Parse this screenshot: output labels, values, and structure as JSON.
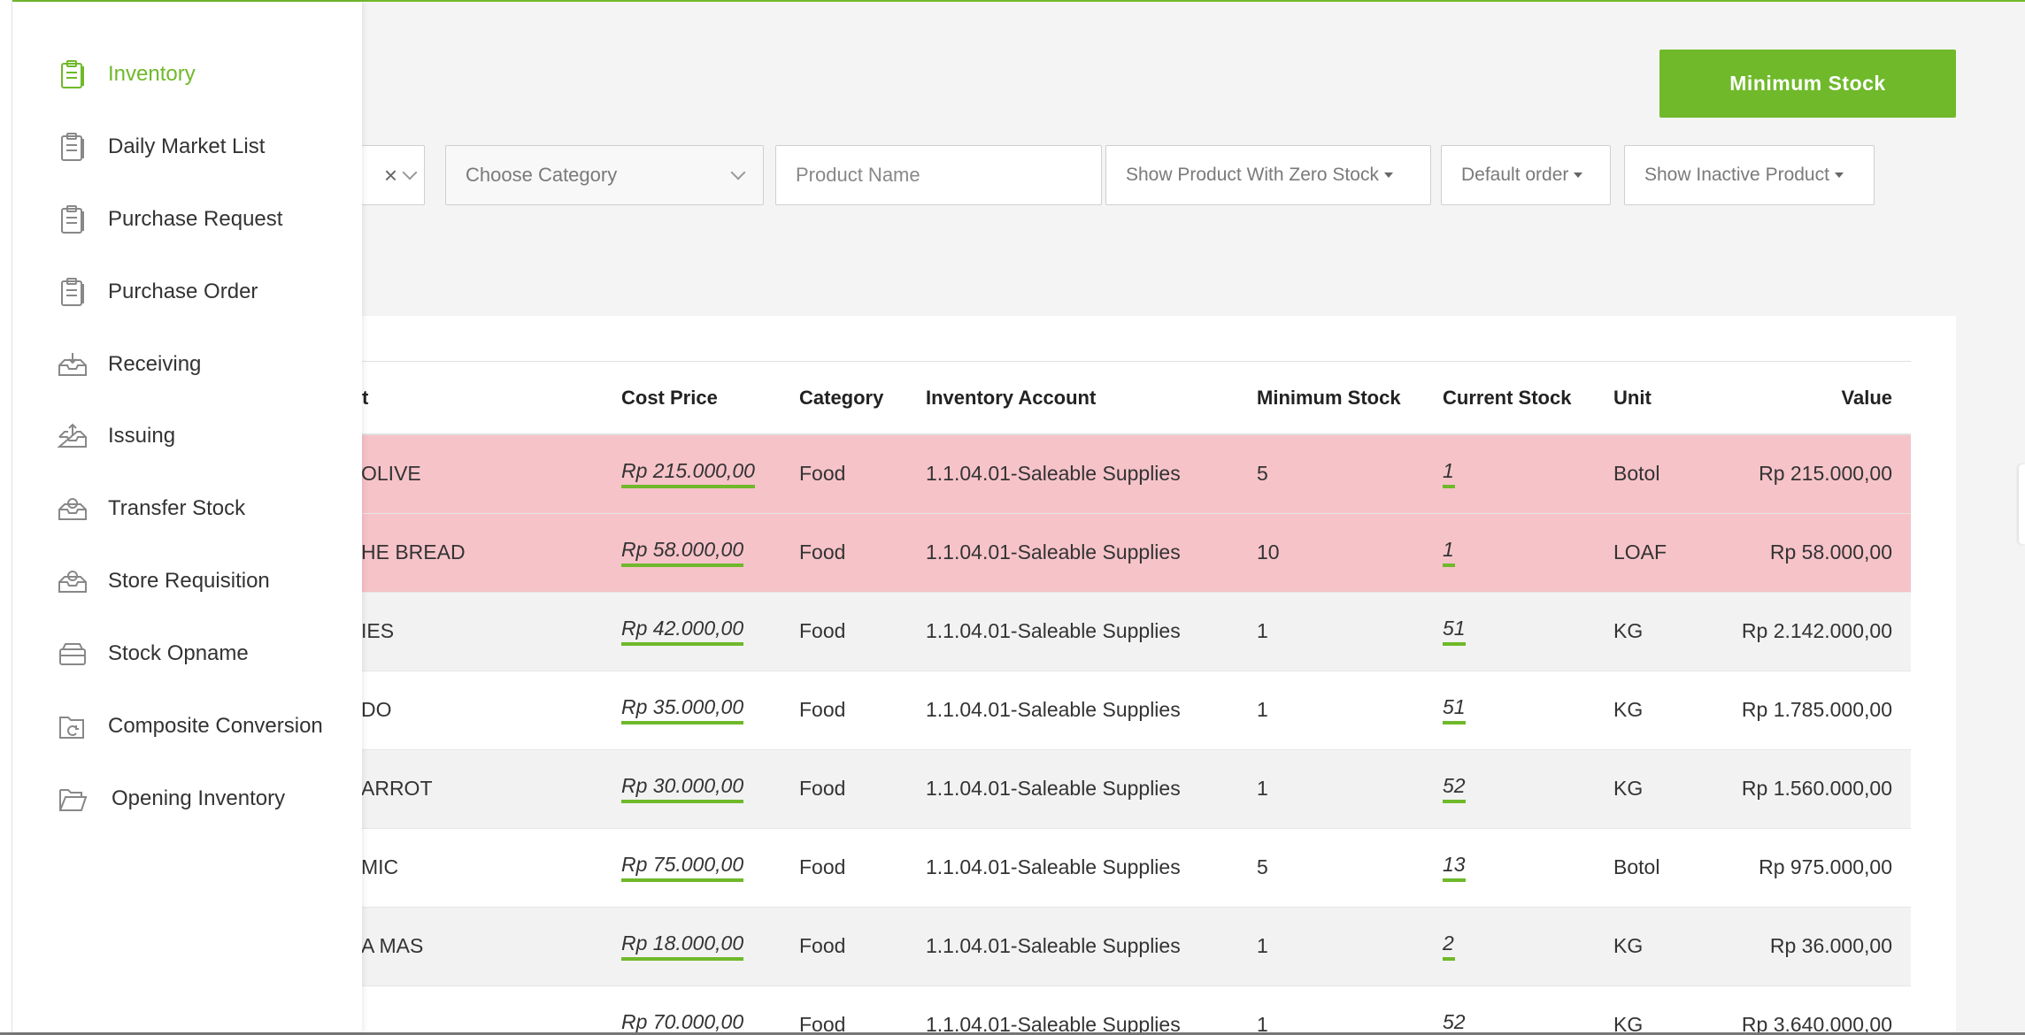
{
  "sidebar": {
    "items": [
      {
        "label": "Inventory",
        "icon": "clipboard-icon",
        "active": true
      },
      {
        "label": "Daily Market List",
        "icon": "clipboard-icon"
      },
      {
        "label": "Purchase Request",
        "icon": "clipboard-icon"
      },
      {
        "label": "Purchase Order",
        "icon": "clipboard-icon"
      },
      {
        "label": "Receiving",
        "icon": "tray-in-icon"
      },
      {
        "label": "Issuing",
        "icon": "tray-out-icon"
      },
      {
        "label": "Transfer Stock",
        "icon": "tray-transfer-icon"
      },
      {
        "label": "Store Requisition",
        "icon": "tray-transfer-icon"
      },
      {
        "label": "Stock Opname",
        "icon": "box-icon"
      },
      {
        "label": "Composite Conversion",
        "icon": "folder-refresh-icon"
      },
      {
        "label": "Opening Inventory",
        "icon": "folder-open-icon"
      }
    ],
    "active_color": "#6fb92a"
  },
  "toolbar": {
    "minimum_stock_label": "Minimum Stock",
    "clear_symbol": "×",
    "choose_category_placeholder": "Choose Category",
    "product_name_placeholder": "Product Name",
    "zero_stock_label": "Show Product With Zero Stock",
    "default_order_label": "Default order",
    "inactive_label": "Show Inactive Product"
  },
  "table": {
    "headers": {
      "name": "t",
      "cost": "Cost Price",
      "category": "Category",
      "account": "Inventory Account",
      "minimum": "Minimum Stock",
      "current": "Current Stock",
      "unit": "Unit",
      "value": "Value"
    },
    "rows": [
      {
        "name": "OLIVE",
        "cost": "Rp 215.000,00",
        "category": "Food",
        "account": "1.1.04.01-Saleable Supplies",
        "minimum": "5",
        "current": "1",
        "unit": "Botol",
        "value": "Rp 215.000,00",
        "status": "low"
      },
      {
        "name": "HE BREAD",
        "cost": "Rp 58.000,00",
        "category": "Food",
        "account": "1.1.04.01-Saleable Supplies",
        "minimum": "10",
        "current": "1",
        "unit": "LOAF",
        "value": "Rp 58.000,00",
        "status": "low"
      },
      {
        "name": "IES",
        "cost": "Rp 42.000,00",
        "category": "Food",
        "account": "1.1.04.01-Saleable Supplies",
        "minimum": "1",
        "current": "51",
        "unit": "KG",
        "value": "Rp 2.142.000,00",
        "status": "alt"
      },
      {
        "name": "DO",
        "cost": "Rp 35.000,00",
        "category": "Food",
        "account": "1.1.04.01-Saleable Supplies",
        "minimum": "1",
        "current": "51",
        "unit": "KG",
        "value": "Rp 1.785.000,00",
        "status": "plain"
      },
      {
        "name": "ARROT",
        "cost": "Rp 30.000,00",
        "category": "Food",
        "account": "1.1.04.01-Saleable Supplies",
        "minimum": "1",
        "current": "52",
        "unit": "KG",
        "value": "Rp 1.560.000,00",
        "status": "alt"
      },
      {
        "name": "MIC",
        "cost": "Rp 75.000,00",
        "category": "Food",
        "account": "1.1.04.01-Saleable Supplies",
        "minimum": "5",
        "current": "13",
        "unit": "Botol",
        "value": "Rp 975.000,00",
        "status": "plain"
      },
      {
        "name": "A MAS",
        "cost": "Rp 18.000,00",
        "category": "Food",
        "account": "1.1.04.01-Saleable Supplies",
        "minimum": "1",
        "current": "2",
        "unit": "KG",
        "value": "Rp 36.000,00",
        "status": "alt"
      },
      {
        "name": "",
        "cost": "Rp 70.000,00",
        "category": "Food",
        "account": "1.1.04.01-Saleable Supplies",
        "minimum": "1",
        "current": "52",
        "unit": "KG",
        "value": "Rp 3.640.000,00",
        "status": "plain"
      }
    ],
    "low_stock_color": "#f6c3c9"
  }
}
